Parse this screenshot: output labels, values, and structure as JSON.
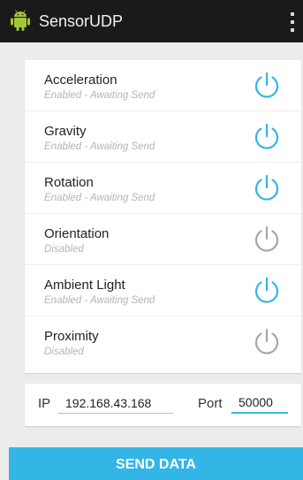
{
  "actionbar": {
    "title": "SensorUDP",
    "app_icon": "android-icon",
    "overflow_icon": "overflow-menu-icon"
  },
  "colors": {
    "enabled_accent": "#33b5e5",
    "disabled_gray": "#a6a6a6",
    "actionbar_bg": "#1a1a1a",
    "background": "#ececec"
  },
  "sensors": [
    {
      "label": "Acceleration",
      "status": "Enabled - Awaiting Send",
      "enabled": true
    },
    {
      "label": "Gravity",
      "status": "Enabled - Awaiting Send",
      "enabled": true
    },
    {
      "label": "Rotation",
      "status": "Enabled - Awaiting Send",
      "enabled": true
    },
    {
      "label": "Orientation",
      "status": "Disabled",
      "enabled": false
    },
    {
      "label": "Ambient Light",
      "status": "Enabled - Awaiting Send",
      "enabled": true
    },
    {
      "label": "Proximity",
      "status": "Disabled",
      "enabled": false
    }
  ],
  "network": {
    "ip_label": "IP",
    "ip_value": "192.168.43.168",
    "port_label": "Port",
    "port_value": "50000"
  },
  "send_button": {
    "label": "SEND DATA"
  }
}
